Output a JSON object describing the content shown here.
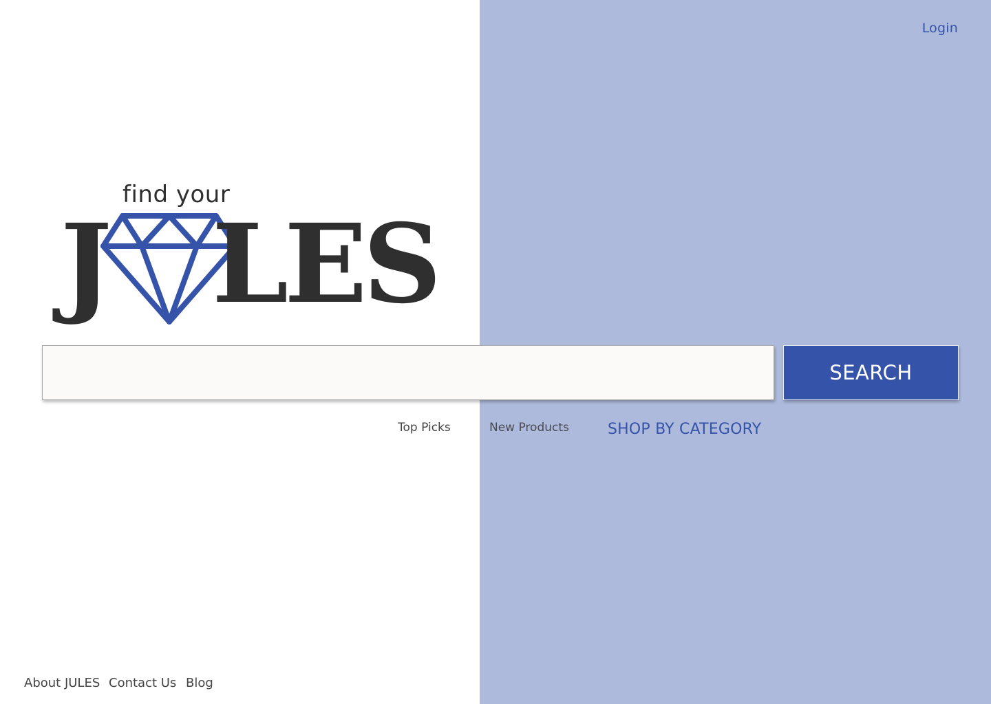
{
  "header": {
    "login_label": "Login"
  },
  "logo": {
    "tagline": "find your",
    "j_letter": "J",
    "les_letters": "LES",
    "gem_icon": "diamond-icon",
    "gem_color": "#3553a8",
    "text_color": "#2f2f2f"
  },
  "search": {
    "placeholder": "",
    "value": "",
    "button_label": "SEARCH"
  },
  "nav": {
    "top_picks": "Top Picks",
    "new_products": "New Products",
    "shop_by_category": "SHOP BY CATEGORY"
  },
  "footer": {
    "about": "About JULES",
    "contact": "Contact Us",
    "blog": "Blog"
  },
  "colors": {
    "accent": "#3553a8",
    "panel": "#adbadc",
    "background": "#ffffff"
  }
}
